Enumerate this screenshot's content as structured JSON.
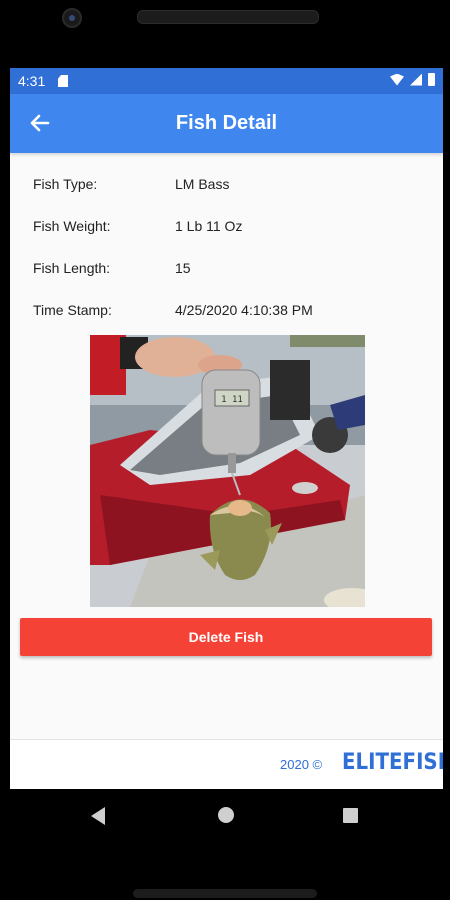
{
  "status_bar": {
    "time": "4:31",
    "icons": [
      "sd-card-icon",
      "wifi-icon",
      "signal-icon",
      "battery-icon"
    ]
  },
  "app_bar": {
    "title": "Fish Detail",
    "back_icon": "arrow-left-icon",
    "color": "#3f86ef"
  },
  "fish": {
    "type_label": "Fish Type:",
    "type_value": "LM Bass",
    "weight_label": "Fish Weight:",
    "weight_value": "1 Lb 11 Oz",
    "length_label": "Fish Length:",
    "length_value": "15",
    "timestamp_label": "Time Stamp:",
    "timestamp_value": "4/25/2020 4:10:38 PM"
  },
  "photo": {
    "scale_readout": "1 11"
  },
  "actions": {
    "delete_label": "Delete Fish",
    "delete_color": "#f44336"
  },
  "footer": {
    "copyright": "2020 ©",
    "logo_text": "ELITEFISH",
    "brand_color": "#2f6fd6"
  },
  "nav": {
    "icons": [
      "back-triangle-icon",
      "home-circle-icon",
      "recents-square-icon"
    ]
  }
}
